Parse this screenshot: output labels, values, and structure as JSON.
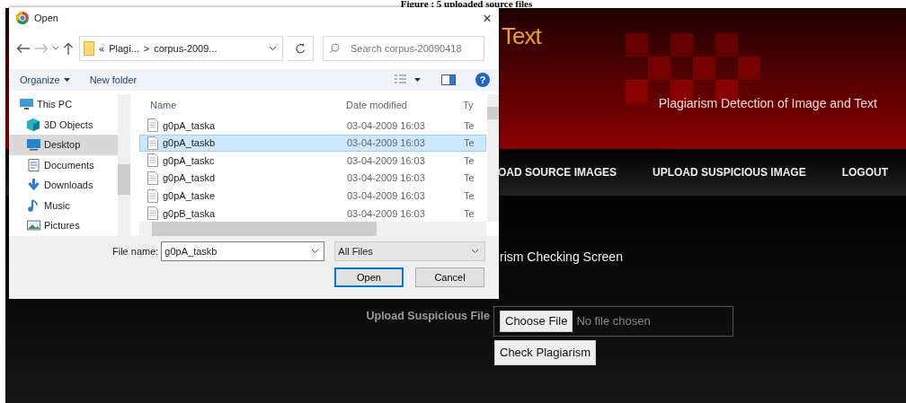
{
  "caption": "Figure : 5 uploaded source files",
  "site": {
    "logo": "Text",
    "tagline": "Plagiarism Detection of Image and Text",
    "nav": [
      {
        "label": "OAD SOURCE IMAGES"
      },
      {
        "label": "UPLOAD SUSPICIOUS IMAGE"
      },
      {
        "label": "LOGOUT"
      }
    ],
    "heading": "rism Checking Screen",
    "form": {
      "label": "Upload Suspicious File",
      "file_button": "Choose File",
      "file_status": "No file chosen",
      "submit": "Check Plagiarism"
    }
  },
  "dialog": {
    "title": "Open",
    "close": "×",
    "address": {
      "overflow": "«",
      "segments": [
        "Plagi...",
        "corpus-2009..."
      ],
      "separator": ">"
    },
    "search": {
      "placeholder": "Search corpus-20090418"
    },
    "toolbar": [
      {
        "label": "Organize",
        "menu": true
      },
      {
        "label": "New folder",
        "menu": false
      }
    ],
    "help": "?",
    "sidebar": [
      {
        "label": "This PC",
        "kind": "pc",
        "selected": false,
        "children": [
          {
            "label": "3D Objects",
            "kind": "cube",
            "selected": false
          },
          {
            "label": "Desktop",
            "kind": "desktop",
            "selected": true
          },
          {
            "label": "Documents",
            "kind": "doc",
            "selected": false
          },
          {
            "label": "Downloads",
            "kind": "download",
            "selected": false
          },
          {
            "label": "Music",
            "kind": "music",
            "selected": false
          },
          {
            "label": "Pictures",
            "kind": "pictures",
            "selected": false
          }
        ]
      }
    ],
    "columns": [
      "Name",
      "Date modified",
      "Ty"
    ],
    "rows": [
      {
        "name": "g0pA_taska",
        "date": "03-04-2009 16:03",
        "type": "Te",
        "selected": false
      },
      {
        "name": "g0pA_taskb",
        "date": "03-04-2009 16:03",
        "type": "Te",
        "selected": true
      },
      {
        "name": "g0pA_taskc",
        "date": "03-04-2009 16:03",
        "type": "Te",
        "selected": false
      },
      {
        "name": "g0pA_taskd",
        "date": "03-04-2009 16:03",
        "type": "Te",
        "selected": false
      },
      {
        "name": "g0pA_taske",
        "date": "03-04-2009 16:03",
        "type": "Te",
        "selected": false
      },
      {
        "name": "g0pB_taska",
        "date": "03-04-2009 16:03",
        "type": "Te",
        "selected": false
      }
    ],
    "file_name_label": "File name:",
    "file_name": "g0pA_taskb",
    "file_type": "All Files",
    "buttons": [
      {
        "label": "Open",
        "default": true
      },
      {
        "label": "Cancel",
        "default": false
      }
    ]
  }
}
